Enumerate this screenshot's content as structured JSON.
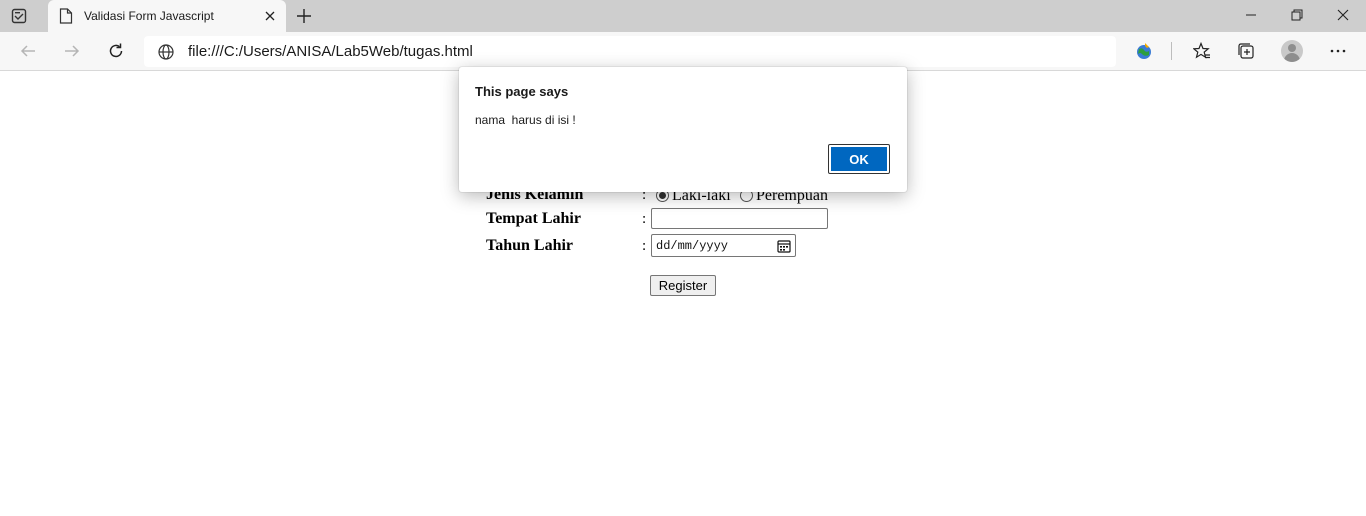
{
  "browser": {
    "tab_title": "Validasi Form Javascript",
    "address": "file:///C:/Users/ANISA/Lab5Web/tugas.html",
    "icons": {
      "tab_actions": "tab-actions-icon",
      "tab_page": "page-icon",
      "tab_close": "close-icon",
      "new_tab": "plus-icon",
      "back": "back-arrow-icon",
      "forward": "forward-arrow-icon",
      "refresh": "refresh-icon",
      "site_info": "globe-icon",
      "extension": "extension-globe-icon",
      "favorites": "favorites-star-icon",
      "collections": "collections-icon",
      "profile": "profile-avatar-icon",
      "more": "more-dots-icon"
    }
  },
  "form": {
    "gender_label": "Jenis Kelamin",
    "gender_colon": ":",
    "gender_options": [
      "Laki-laki",
      "Perempuan"
    ],
    "gender_selected": "Laki-laki",
    "birthplace_label": "Tempat Lahir",
    "birthplace_colon": ":",
    "birthplace_value": "",
    "birthyear_label": "Tahun Lahir",
    "birthyear_colon": ":",
    "birthyear_placeholder": "dd/mm/yyyy",
    "register_label": "Register"
  },
  "dialog": {
    "title": "This page says",
    "message": "nama  harus di isi !",
    "ok_label": "OK"
  },
  "colors": {
    "accent": "#0067c0",
    "tabstrip": "#cecece",
    "toolbar": "#f7f7f7"
  }
}
